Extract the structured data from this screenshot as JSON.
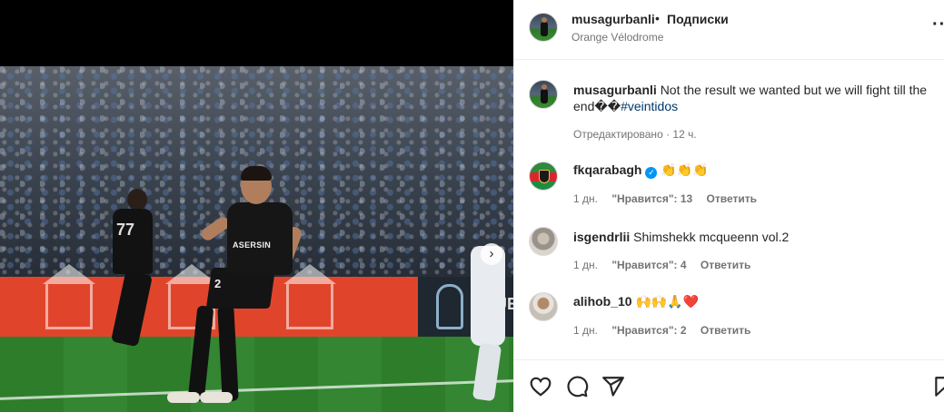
{
  "header": {
    "username": "musagurbanli",
    "separator": "•",
    "follow_status": "Подписки",
    "location": "Orange Vélodrome",
    "more_label": "···"
  },
  "media": {
    "shirt_sponsor": "ASERSIN",
    "shirt_number_main": "2",
    "shirt_number_back": "77",
    "board_text": "UEF",
    "next_arrow": "›"
  },
  "caption": {
    "username": "musagurbanli",
    "text": "Not the result we wanted but we will fight till the end🤝💪",
    "text_display": "Not the result we wanted but we will fight till the end��",
    "hashtag": "#veintidos",
    "meta": "Отредактировано · 12 ч."
  },
  "comments": [
    {
      "username": "fkqarabagh",
      "verified": true,
      "verified_mark": "✓",
      "text": "👏👏👏",
      "time": "1 дн.",
      "likes": "\"Нравится\": 13",
      "reply": "Ответить"
    },
    {
      "username": "isgendrlii",
      "verified": false,
      "text": "Shimshekk mcqueenn vol.2",
      "time": "1 дн.",
      "likes": "\"Нравится\": 4",
      "reply": "Ответить"
    },
    {
      "username": "alihob_10",
      "verified": false,
      "text": "🙌🙌🙏❤️",
      "time": "1 дн.",
      "likes": "\"Нравится\": 2",
      "reply": "Ответить"
    }
  ],
  "actions": {
    "icons": [
      "heart-icon",
      "comment-icon",
      "share-icon",
      "bookmark-icon"
    ]
  },
  "colors": {
    "link": "#00376b",
    "secondary_text": "#737373",
    "verified": "#0095f6",
    "divider": "#efefef"
  }
}
